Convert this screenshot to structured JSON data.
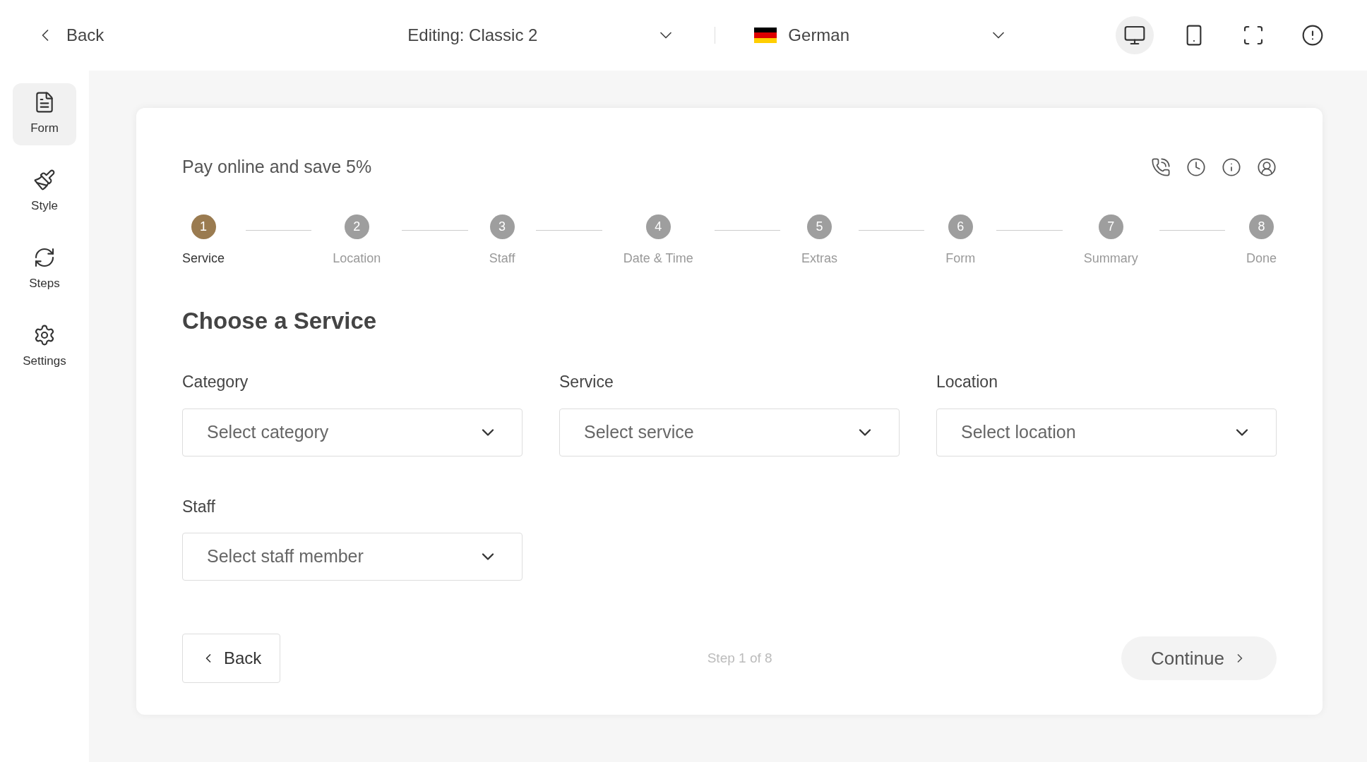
{
  "top_bar": {
    "back": "Back",
    "editing": "Editing: Classic 2",
    "language": "German",
    "views": [
      {
        "kind": "desktop",
        "selected": true
      },
      {
        "kind": "mobile",
        "selected": false
      },
      {
        "kind": "fullscreen",
        "selected": false
      },
      {
        "kind": "alert",
        "selected": false
      }
    ]
  },
  "sidebar": {
    "items": [
      {
        "kind": "form",
        "label": "Form",
        "selected": true
      },
      {
        "kind": "style",
        "label": "Style",
        "selected": false
      },
      {
        "kind": "steps",
        "label": "Steps",
        "selected": false
      },
      {
        "kind": "settings",
        "label": "Settings",
        "selected": false
      }
    ]
  },
  "form": {
    "banner": "Pay online and save 5%",
    "steps": [
      {
        "number": "1",
        "label": "Service",
        "selected": true
      },
      {
        "number": "2",
        "label": "Location",
        "selected": false
      },
      {
        "number": "3",
        "label": "Staff",
        "selected": false
      },
      {
        "number": "4",
        "label": "Date & Time",
        "selected": false
      },
      {
        "number": "5",
        "label": "Extras",
        "selected": false
      },
      {
        "number": "6",
        "label": "Form",
        "selected": false
      },
      {
        "number": "7",
        "label": "Summary",
        "selected": false
      },
      {
        "number": "8",
        "label": "Done",
        "selected": false
      }
    ],
    "heading": "Choose a Service",
    "fields": [
      {
        "label": "Category",
        "placeholder": "Select category"
      },
      {
        "label": "Service",
        "placeholder": "Select service"
      },
      {
        "label": "Location",
        "placeholder": "Select location"
      },
      {
        "label": "Staff",
        "placeholder": "Select staff member"
      }
    ],
    "back": "Back",
    "step_counter": "Step 1 of 8",
    "continue": "Continue"
  }
}
